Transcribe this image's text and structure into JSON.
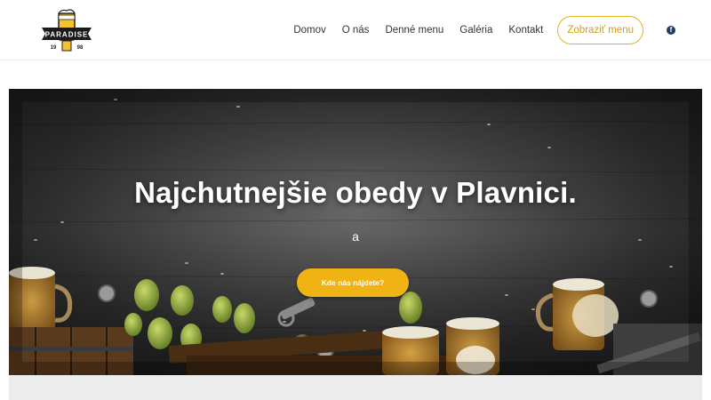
{
  "header": {
    "logo_alt": "Paradise",
    "logo_text": "PARADISE",
    "logo_year_left": "19",
    "logo_year_right": "98",
    "nav": [
      {
        "label": "Domov"
      },
      {
        "label": "O nás"
      },
      {
        "label": "Denné menu"
      },
      {
        "label": "Galéria"
      },
      {
        "label": "Kontakt"
      }
    ],
    "cta_label": "Zobraziť menu",
    "social_icon": "facebook-icon"
  },
  "hero": {
    "title": "Najchutnejšie obedy v Plavnici.",
    "subtitle": "a",
    "button_label": "Kde nás nájdete?"
  },
  "colors": {
    "accent": "#f0b314",
    "nav_text": "#333333",
    "facebook": "#1f3c64"
  }
}
